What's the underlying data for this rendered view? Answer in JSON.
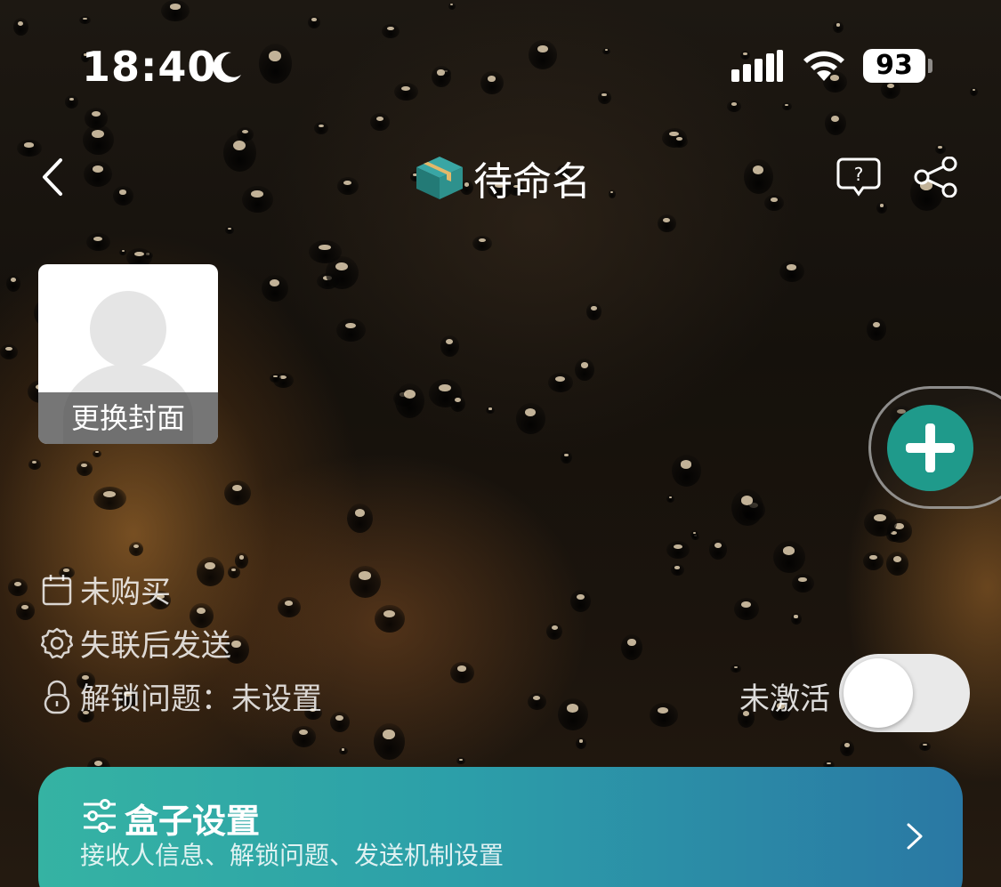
{
  "status_bar": {
    "time": "18:40",
    "battery": "93"
  },
  "nav": {
    "title": "待命名"
  },
  "cover": {
    "label": "更换封面"
  },
  "info": {
    "purchase_status": "未购买",
    "send_mode": "失联后发送",
    "unlock_question": "解锁问题：未设置"
  },
  "activation": {
    "label": "未激活",
    "enabled": false
  },
  "settings_card": {
    "title": "盒子设置",
    "subtitle": "接收人信息、解锁问题、发送机制设置"
  },
  "colors": {
    "accent": "#1f9a8b",
    "card_gradient_start": "#35b3a3",
    "card_gradient_end": "#2a78a4"
  }
}
